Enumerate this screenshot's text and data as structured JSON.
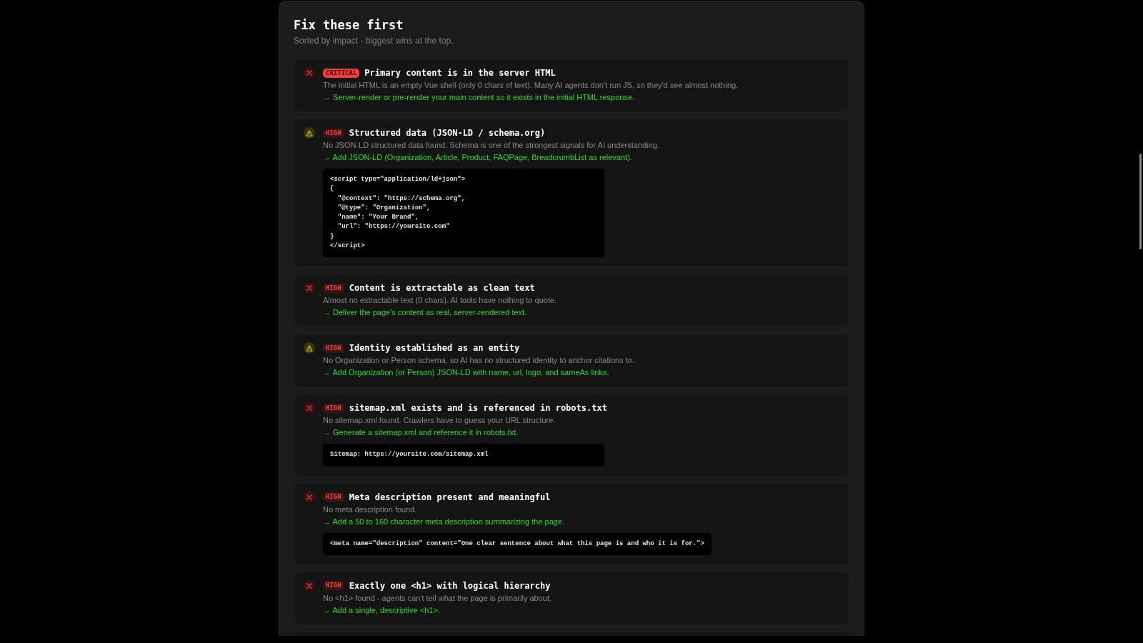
{
  "section": {
    "title": "Fix these first",
    "subtitle": "Sorted by impact - biggest wins at the top."
  },
  "issues": [
    {
      "kind": "fail",
      "severity": {
        "label": "CRITICAL",
        "kind": "critical"
      },
      "title": "Primary content is in the server HTML",
      "description": "The initial HTML is an empty Vue shell (only 0 chars of text). Many AI agents don't run JS, so they'd see almost nothing.",
      "fix": "→ Server-render or pre-render your main content so it exists in the initial HTML response."
    },
    {
      "kind": "warning",
      "severity": {
        "label": "HIGH",
        "kind": "high"
      },
      "title": "Structured data (JSON-LD / schema.org)",
      "description": "No JSON-LD structured data found. Schema is one of the strongest signals for AI understanding.",
      "fix": "→ Add JSON-LD (Organization, Article, Product, FAQPage, BreadcrumbList as relevant).",
      "code": "<script type=\"application/ld+json\">\n{\n  \"@context\": \"https://schema.org\",\n  \"@type\": \"Organization\",\n  \"name\": \"Your Brand\",\n  \"url\": \"https://yoursite.com\"\n}\n</script>"
    },
    {
      "kind": "fail",
      "severity": {
        "label": "HIGH",
        "kind": "high"
      },
      "title": "Content is extractable as clean text",
      "description": "Almost no extractable text (0 chars). AI tools have nothing to quote.",
      "fix": "→ Deliver the page's content as real, server-rendered text."
    },
    {
      "kind": "warning",
      "severity": {
        "label": "HIGH",
        "kind": "high"
      },
      "title": "Identity established as an entity",
      "description": "No Organization or Person schema, so AI has no structured identity to anchor citations to.",
      "fix": "→ Add Organization (or Person) JSON-LD with name, url, logo, and sameAs links."
    },
    {
      "kind": "fail",
      "severity": {
        "label": "HIGH",
        "kind": "high"
      },
      "title": "sitemap.xml exists and is referenced in robots.txt",
      "description": "No sitemap.xml found. Crawlers have to guess your URL structure.",
      "fix": "→ Generate a sitemap.xml and reference it in robots.txt.",
      "code": "Sitemap: https://yoursite.com/sitemap.xml"
    },
    {
      "kind": "fail",
      "severity": {
        "label": "HIGH",
        "kind": "high"
      },
      "title": "Meta description present and meaningful",
      "description": "No meta description found.",
      "fix": "→ Add a 50 to 160 character meta description summarizing the page.",
      "code": "<meta name=\"description\" content=\"One clear sentence about what this page is and who it is for.\">"
    },
    {
      "kind": "fail",
      "severity": {
        "label": "HIGH",
        "kind": "high"
      },
      "title": "Exactly one <h1> with logical hierarchy",
      "description": "No <h1> found - agents can't tell what the page is primarily about.",
      "fix": "→ Add a single, descriptive <h1>."
    }
  ]
}
